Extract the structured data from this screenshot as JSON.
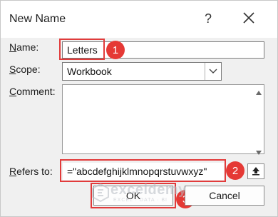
{
  "dialog": {
    "title": "New Name",
    "help_label": "?",
    "close_icon": "close-icon"
  },
  "form": {
    "name_label": "Name:",
    "name_value": "Letters",
    "scope_label": "Scope:",
    "scope_value": "Workbook",
    "comment_label": "Comment:",
    "comment_value": "",
    "refers_label": "Refers to:",
    "refers_value": "=\"abcdefghijklmnopqrstuvwxyz\""
  },
  "buttons": {
    "ok_label": "OK",
    "cancel_label": "Cancel"
  },
  "annotations": {
    "step1": "1",
    "step2": "2",
    "step3": "3",
    "highlight_color": "#e23b3b"
  },
  "watermark": {
    "text": "exceldemy",
    "subtext": "EXCEL · DATA · BI"
  }
}
